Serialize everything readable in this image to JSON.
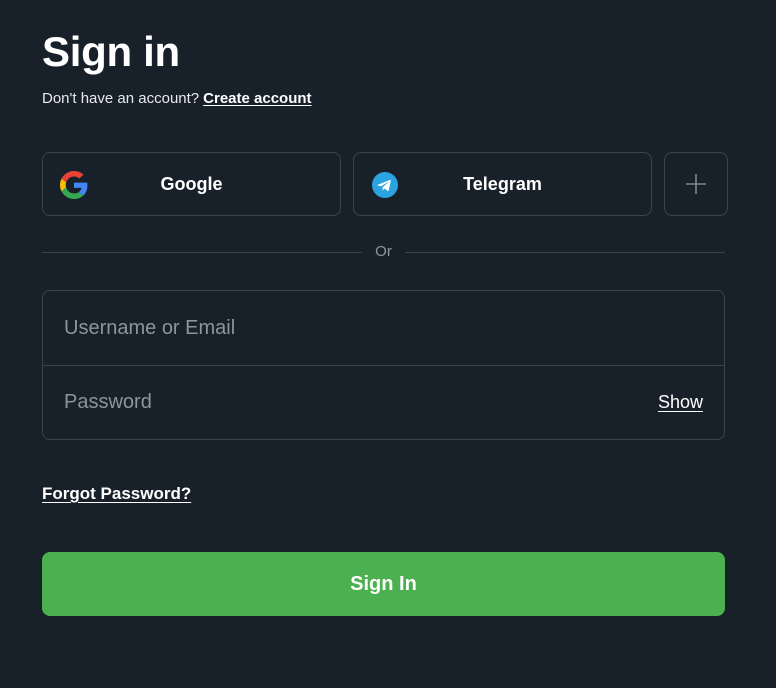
{
  "header": {
    "title": "Sign in",
    "no_account_text": "Don't have an account?",
    "create_account_link": "Create account"
  },
  "social": {
    "google_label": "Google",
    "telegram_label": "Telegram",
    "more_icon": "plus-icon"
  },
  "divider": {
    "label": "Or"
  },
  "form": {
    "username_placeholder": "Username or Email",
    "password_placeholder": "Password",
    "show_label": "Show",
    "forgot_label": "Forgot Password?",
    "submit_label": "Sign In"
  },
  "colors": {
    "background": "#18212a",
    "border": "#3a434c",
    "primary": "#4caf50",
    "telegram": "#2aa3e0"
  }
}
